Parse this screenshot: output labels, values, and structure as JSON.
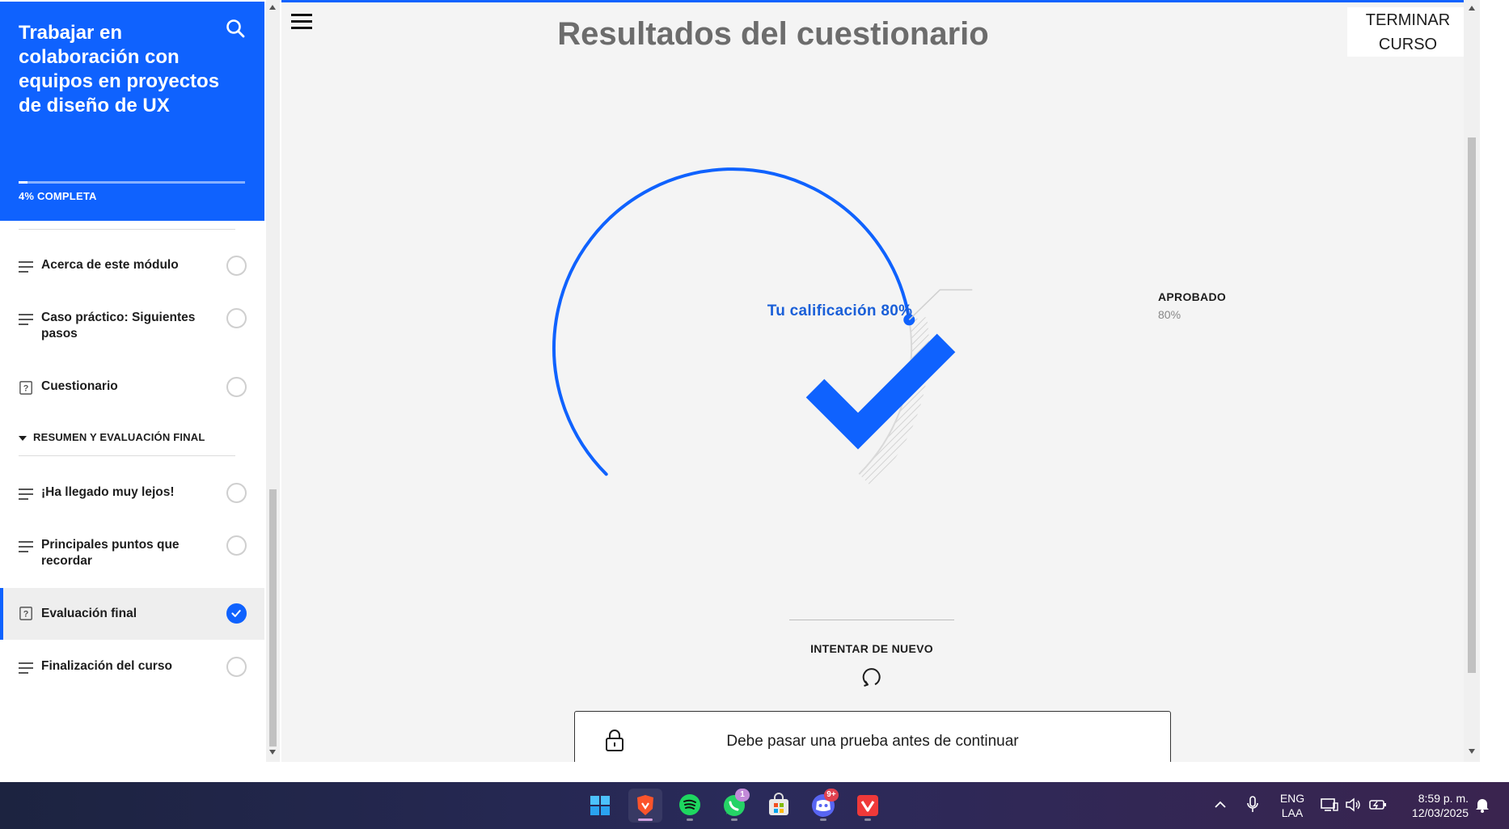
{
  "sidebar": {
    "course_title": "Trabajar en colaboración con equipos en proyectos de diseño de UX",
    "progress_percent": 4,
    "progress_label": "4% COMPLETA",
    "lessons_top": [
      {
        "label": "Acerca de este módulo",
        "icon": "lines-icon",
        "done": false
      },
      {
        "label": "Caso práctico: Siguientes pasos",
        "icon": "lines-icon",
        "done": false
      },
      {
        "label": "Cuestionario",
        "icon": "quiz-icon",
        "done": false
      }
    ],
    "section_title": "RESUMEN Y EVALUACIÓN FINAL",
    "lessons_section": [
      {
        "label": "¡Ha llegado muy lejos!",
        "icon": "lines-icon",
        "done": false
      },
      {
        "label": "Principales puntos que recordar",
        "icon": "lines-icon",
        "done": false
      },
      {
        "label": "Evaluación final",
        "icon": "quiz-icon",
        "done": true,
        "active": true
      },
      {
        "label": "Finalización del curso",
        "icon": "lines-icon",
        "done": false
      }
    ]
  },
  "main": {
    "page_title": "Resultados del cuestionario",
    "finish_button": "TERMINAR CURSO",
    "score_label": "Tu calificación 80%",
    "score_percent": 80,
    "pass_label": "APROBADO",
    "pass_value": "80%",
    "retry_label": "INTENTAR DE NUEVO",
    "locked_message": "Debe pasar una prueba antes de continuar"
  },
  "colors": {
    "accent": "#0f62fe",
    "score_text": "#1a5fd8"
  },
  "taskbar": {
    "apps": [
      {
        "name": "windows-start-icon"
      },
      {
        "name": "brave-browser-icon",
        "active": true
      },
      {
        "name": "spotify-icon"
      },
      {
        "name": "whatsapp-icon",
        "badge": "1"
      },
      {
        "name": "microsoft-store-icon"
      },
      {
        "name": "discord-icon",
        "badge": "9+"
      },
      {
        "name": "vivaldi-icon"
      }
    ],
    "lang_line1": "ENG",
    "lang_line2": "LAA",
    "time": "8:59 p. m.",
    "date": "12/03/2025"
  }
}
